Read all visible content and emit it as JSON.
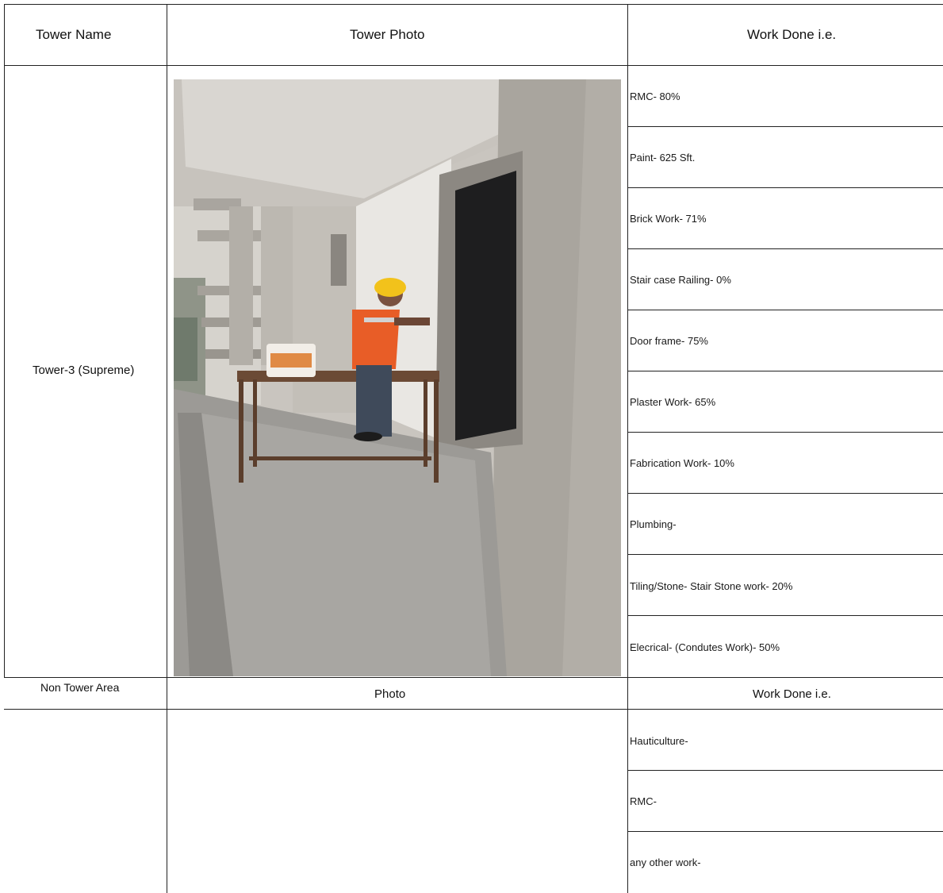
{
  "header": {
    "col1": "Tower Name",
    "col2": "Tower Photo",
    "col3": "Work Done i.e."
  },
  "tower": {
    "name": "Tower-3 (Supreme)",
    "work_items": [
      "RMC- 80%",
      "Paint- 625 Sft.",
      "Brick Work- 71%",
      "Stair case Railing- 0%",
      "Door frame- 75%",
      "Plaster Work-  65%",
      "Fabrication Work- 10%",
      "Plumbing-",
      "Tiling/Stone- Stair Stone work- 20%",
      "Elecrical- (Condutes Work)- 50%"
    ]
  },
  "non_tower": {
    "col1": "Non Tower Area",
    "col2": "Photo",
    "col3": "Work Done i.e.",
    "work_items": [
      "Hauticulture-",
      "RMC-",
      "any other work-"
    ]
  },
  "colors": {
    "grid_line": "#222222",
    "concrete": "#b9b6b1",
    "vest": "#e85d27",
    "helmet": "#f2c21b"
  }
}
